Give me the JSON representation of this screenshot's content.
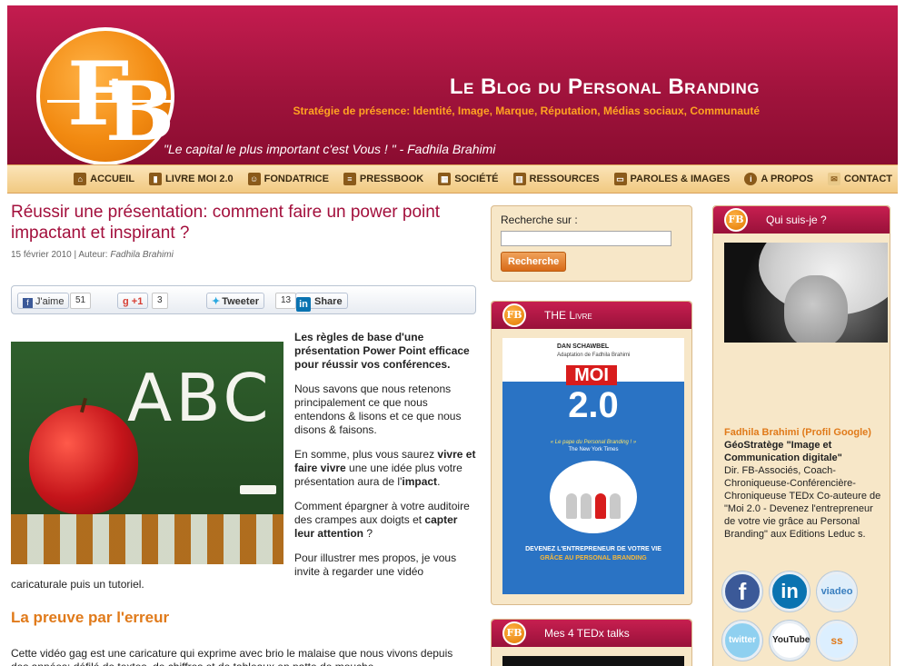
{
  "header": {
    "title": "Le Blog du Personal Branding",
    "subtitle": "Stratégie de présence: Identité, Image, Marque, Réputation, Médias sociaux, Communauté",
    "quote": "\"Le capital le plus important c'est Vous ! \" - Fadhila Brahimi",
    "logo_text_f": "F",
    "logo_text_b": "B",
    "accent_color": "#a0133c",
    "orange_color": "#f28a11"
  },
  "nav": {
    "items": [
      {
        "label": "ACCUEIL",
        "icon": "home-icon"
      },
      {
        "label": "LIVRE MOI 2.0",
        "icon": "book-icon"
      },
      {
        "label": "FONDATRICE",
        "icon": "person-icon"
      },
      {
        "label": "PRESSBOOK",
        "icon": "newspaper-icon"
      },
      {
        "label": "SOCIÉTÉ",
        "icon": "building-icon"
      },
      {
        "label": "RESSOURCES",
        "icon": "books-icon"
      },
      {
        "label": "PAROLES & IMAGES",
        "icon": "video-icon"
      },
      {
        "label": "A PROPOS",
        "icon": "info-icon"
      },
      {
        "label": "CONTACT",
        "icon": "mail-icon"
      }
    ]
  },
  "post": {
    "title": "Réussir une présentation: comment faire un power point impactant et inspirant ?",
    "date": "15 février 2010",
    "separator": " | Auteur: ",
    "author": "Fadhila Brahimi",
    "share": {
      "facebook_label": "J'aime",
      "facebook_count": "51",
      "gplus_label": "+1",
      "gplus_count": "3",
      "twitter_label": "Tweeter",
      "twitter_count": "13",
      "linkedin_label": "Share"
    },
    "image_text": "ABC",
    "intro_bold": "Les règles de base d'une présentation Power Point efficace pour réussir vos conférences.",
    "p1": "Nous savons que nous retenons principalement ce que nous entendons & lisons et ce que nous disons & faisons.",
    "p2_a": "En somme, plus vous saurez ",
    "p2_b": "vivre et faire vivre",
    "p2_c": " une  une idée plus votre présentation aura de l'",
    "p2_d": "impact",
    "p2_e": ".",
    "p3_a": "Comment épargner à votre auditoire des crampes aux doigts et ",
    "p3_b": "capter leur attention",
    "p3_c": " ?",
    "p4": "Pour illustrer mes propos, je vous invite à regarder une vidéo",
    "p4_tail": "caricaturale puis un tutoriel.",
    "section_heading": "La preuve par l'erreur",
    "p5": "Cette vidéo gag est une caricature qui exprime avec brio le malaise que nous vivons depuis des années:  défilé de textes, de chiffres et de tableaux en patte de mouche."
  },
  "search": {
    "label": "Recherche sur :",
    "placeholder": "",
    "button": "Recherche"
  },
  "book_widget": {
    "title": "THE Livre",
    "book_author": "DAN SCHAWBEL",
    "book_adapt": "Adaptation de Fadhila Brahimi",
    "book_moi": "MOI",
    "book_version": "2.0",
    "book_tag": "« Le pape du Personal Branding ! »",
    "book_source": "The New York Times",
    "book_bottom_1": "DEVENEZ L'ENTREPRENEUR DE VOTRE VIE",
    "book_bottom_2": "GRÂCE AU PERSONAL BRANDING"
  },
  "tedx_widget": {
    "title": "Mes 4 TEDx talks"
  },
  "about_widget": {
    "title": "Qui suis-je ?",
    "name": "Fadhila Brahimi (Profil Google)",
    "role": " GéoStratège \"Image et Communication digitale\"",
    "desc": "Dir. FB-Associés, Coach-Chroniqueuse-Conférencière-Chroniqueuse TEDx Co-auteure de \"Moi 2.0 - Devenez l'entrepreneur de votre vie grâce au Personal Branding\" aux Editions Leduc s.",
    "social": [
      {
        "name": "facebook-icon",
        "label": "f",
        "color": "#3b5998"
      },
      {
        "name": "linkedin-icon",
        "label": "in",
        "color": "#0a73b1"
      },
      {
        "name": "viadeo-icon",
        "label": "viadeo",
        "color": "#5aa0d6"
      },
      {
        "name": "twitter-icon",
        "label": "twitter",
        "color": "#4cb6e8"
      },
      {
        "name": "youtube-icon",
        "label": "YouTube",
        "color": "#ffffff"
      },
      {
        "name": "slideshare-icon",
        "label": "ss",
        "color": "#6cb7df"
      }
    ]
  }
}
